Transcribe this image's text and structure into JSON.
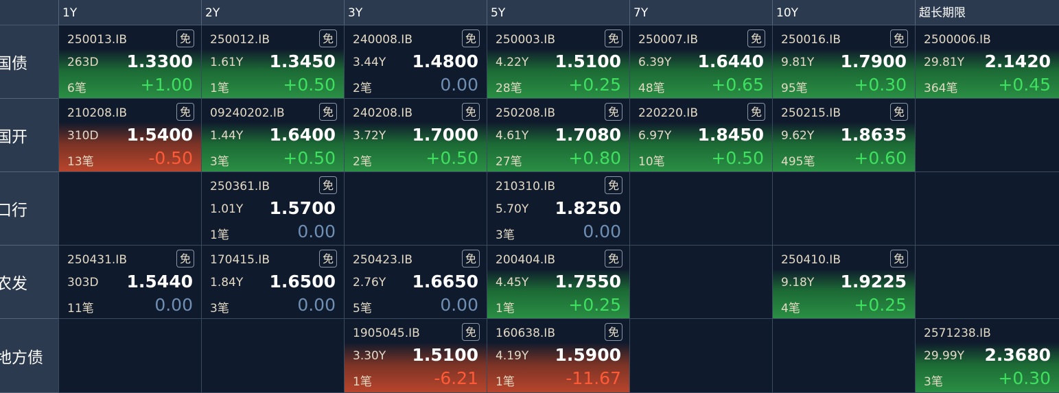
{
  "columns": [
    "1Y",
    "2Y",
    "3Y",
    "5Y",
    "7Y",
    "10Y",
    "超长期限"
  ],
  "colors": {
    "header_bg": "#2c3a50",
    "cell_bg": "#0f1a2c",
    "rise_green": "#2a8f44",
    "fall_red": "#b8452c",
    "positive_text": "#3fe060",
    "negative_text": "#ff5a36",
    "zero_text": "#6f8fb5"
  },
  "rows": [
    {
      "label": "国债",
      "cells": [
        {
          "code": "250013.IB",
          "badge": "免",
          "term": "263D",
          "rate": "1.3300",
          "count": "6笔",
          "change": "+1.00",
          "trend": "up"
        },
        {
          "code": "250012.IB",
          "badge": "免",
          "term": "1.61Y",
          "rate": "1.3450",
          "count": "1笔",
          "change": "+0.50",
          "trend": "up"
        },
        {
          "code": "240008.IB",
          "badge": "免",
          "term": "3.44Y",
          "rate": "1.4800",
          "count": "2笔",
          "change": "0.00",
          "trend": "flat"
        },
        {
          "code": "250003.IB",
          "badge": "免",
          "term": "4.22Y",
          "rate": "1.5100",
          "count": "28笔",
          "change": "+0.25",
          "trend": "up"
        },
        {
          "code": "250007.IB",
          "badge": "免",
          "term": "6.39Y",
          "rate": "1.6440",
          "count": "48笔",
          "change": "+0.65",
          "trend": "up"
        },
        {
          "code": "250016.IB",
          "badge": "免",
          "term": "9.81Y",
          "rate": "1.7900",
          "count": "95笔",
          "change": "+0.30",
          "trend": "up"
        },
        {
          "code": "2500006.IB",
          "badge": "",
          "term": "29.81Y",
          "rate": "2.1420",
          "count": "364笔",
          "change": "+0.45",
          "trend": "up"
        }
      ]
    },
    {
      "label": "国开",
      "cells": [
        {
          "code": "210208.IB",
          "badge": "免",
          "term": "310D",
          "rate": "1.5400",
          "count": "13笔",
          "change": "-0.50",
          "trend": "down"
        },
        {
          "code": "09240202.IB",
          "badge": "免",
          "term": "1.44Y",
          "rate": "1.6400",
          "count": "3笔",
          "change": "+0.50",
          "trend": "up"
        },
        {
          "code": "240208.IB",
          "badge": "免",
          "term": "3.72Y",
          "rate": "1.7000",
          "count": "2笔",
          "change": "+0.50",
          "trend": "up"
        },
        {
          "code": "250208.IB",
          "badge": "免",
          "term": "4.61Y",
          "rate": "1.7080",
          "count": "27笔",
          "change": "+0.80",
          "trend": "up"
        },
        {
          "code": "220220.IB",
          "badge": "免",
          "term": "6.97Y",
          "rate": "1.8450",
          "count": "10笔",
          "change": "+0.50",
          "trend": "up"
        },
        {
          "code": "250215.IB",
          "badge": "免",
          "term": "9.62Y",
          "rate": "1.8635",
          "count": "495笔",
          "change": "+0.60",
          "trend": "up"
        },
        null
      ]
    },
    {
      "label": "口行",
      "cells": [
        null,
        {
          "code": "250361.IB",
          "badge": "免",
          "term": "1.01Y",
          "rate": "1.5700",
          "count": "1笔",
          "change": "0.00",
          "trend": "flat"
        },
        null,
        {
          "code": "210310.IB",
          "badge": "免",
          "term": "5.70Y",
          "rate": "1.8250",
          "count": "3笔",
          "change": "0.00",
          "trend": "flat"
        },
        null,
        null,
        null
      ]
    },
    {
      "label": "农发",
      "cells": [
        {
          "code": "250431.IB",
          "badge": "免",
          "term": "303D",
          "rate": "1.5440",
          "count": "11笔",
          "change": "0.00",
          "trend": "flat"
        },
        {
          "code": "170415.IB",
          "badge": "免",
          "term": "1.84Y",
          "rate": "1.6500",
          "count": "3笔",
          "change": "0.00",
          "trend": "flat"
        },
        {
          "code": "250423.IB",
          "badge": "免",
          "term": "2.76Y",
          "rate": "1.6650",
          "count": "5笔",
          "change": "0.00",
          "trend": "flat"
        },
        {
          "code": "200404.IB",
          "badge": "免",
          "term": "4.45Y",
          "rate": "1.7550",
          "count": "1笔",
          "change": "+0.25",
          "trend": "up"
        },
        null,
        {
          "code": "250410.IB",
          "badge": "免",
          "term": "9.18Y",
          "rate": "1.9225",
          "count": "4笔",
          "change": "+0.25",
          "trend": "up"
        },
        null
      ]
    },
    {
      "label": "地方债",
      "cells": [
        null,
        null,
        {
          "code": "1905045.IB",
          "badge": "免",
          "term": "3.30Y",
          "rate": "1.5100",
          "count": "1笔",
          "change": "-6.21",
          "trend": "down"
        },
        {
          "code": "160638.IB",
          "badge": "免",
          "term": "4.19Y",
          "rate": "1.5900",
          "count": "1笔",
          "change": "-11.67",
          "trend": "down"
        },
        null,
        null,
        {
          "code": "2571238.IB",
          "badge": "",
          "term": "29.99Y",
          "rate": "2.3680",
          "count": "3笔",
          "change": "+0.30",
          "trend": "up"
        }
      ]
    }
  ]
}
